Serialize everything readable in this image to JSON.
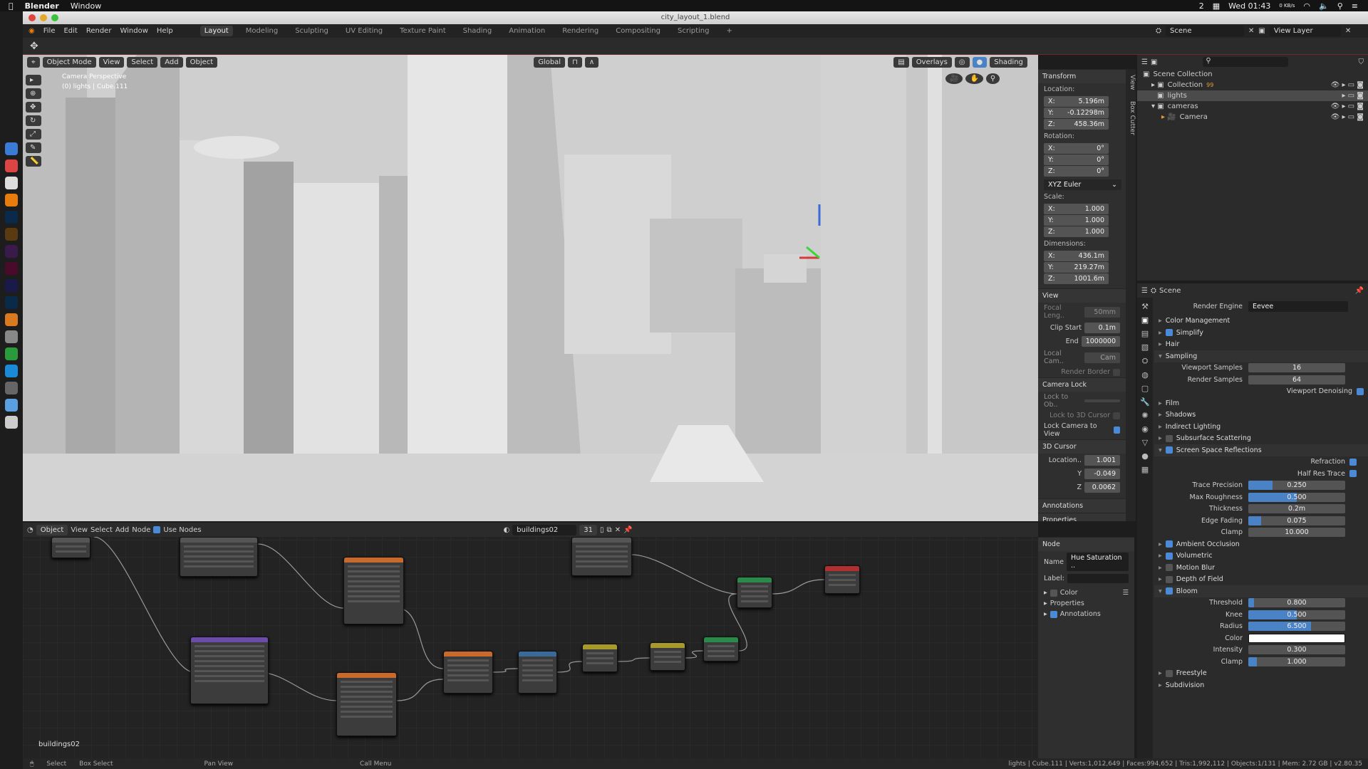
{
  "mac": {
    "app": "Blender",
    "menu": "Window",
    "clock": "Wed 01:43",
    "badge": "2",
    "net": "0 KB/s"
  },
  "window": {
    "title": "city_layout_1.blend"
  },
  "topbar": {
    "menus": [
      "File",
      "Edit",
      "Render",
      "Window",
      "Help"
    ],
    "workspaces": [
      "Layout",
      "Modeling",
      "Sculpting",
      "UV Editing",
      "Texture Paint",
      "Shading",
      "Animation",
      "Rendering",
      "Compositing",
      "Scripting",
      "+"
    ],
    "active": "Layout",
    "scene": "Scene",
    "view_layer": "View Layer"
  },
  "viewport": {
    "mode": "Object Mode",
    "menus": [
      "View",
      "Select",
      "Add",
      "Object"
    ],
    "orientation": "Global",
    "overlays": "Overlays",
    "shading": "Shading",
    "info1": "Camera Perspective",
    "info2": "(0) lights | Cube.111"
  },
  "npanel": {
    "tabs": [
      "View",
      "Box Cutter"
    ],
    "transform": {
      "title": "Transform",
      "location_label": "Location:",
      "location": [
        [
          "X:",
          "5.196m"
        ],
        [
          "Y:",
          "-0.12298m"
        ],
        [
          "Z:",
          "458.36m"
        ]
      ],
      "rotation_label": "Rotation:",
      "rotation": [
        [
          "X:",
          "0°"
        ],
        [
          "Y:",
          "0°"
        ],
        [
          "Z:",
          "0°"
        ]
      ],
      "rotation_mode": "XYZ Euler",
      "scale_label": "Scale:",
      "scale": [
        [
          "X:",
          "1.000"
        ],
        [
          "Y:",
          "1.000"
        ],
        [
          "Z:",
          "1.000"
        ]
      ],
      "dimensions_label": "Dimensions:",
      "dimensions": [
        [
          "X:",
          "436.1m"
        ],
        [
          "Y:",
          "219.27m"
        ],
        [
          "Z:",
          "1001.6m"
        ]
      ]
    },
    "view": {
      "title": "View",
      "focal_label": "Focal Leng..",
      "focal": "50mm",
      "clip_start_label": "Clip Start",
      "clip_start": "0.1m",
      "end_label": "End",
      "end": "1000000",
      "local_cam_label": "Local Cam..",
      "local_cam": "Cam",
      "render_border": "Render Border"
    },
    "camera_lock": {
      "title": "Camera Lock",
      "lock_to_obj": "Lock to Ob..",
      "lock_cursor": "Lock to 3D Cursor",
      "lock_view": "Lock Camera to View"
    },
    "cursor": {
      "title": "3D Cursor",
      "location_label": "Location..",
      "x": "1.001",
      "y_label": "Y",
      "y": "-0.049",
      "z_label": "Z",
      "z": "0.0062"
    },
    "annotations": "Annotations",
    "properties": "Properties"
  },
  "outliner": {
    "items": [
      {
        "name": "Scene Collection",
        "indent": 0
      },
      {
        "name": "Collection",
        "indent": 1,
        "badge": "99"
      },
      {
        "name": "lights",
        "indent": 1,
        "selected": true
      },
      {
        "name": "cameras",
        "indent": 1
      },
      {
        "name": "Camera",
        "indent": 2
      }
    ]
  },
  "properties": {
    "context": "Scene",
    "render_engine_label": "Render Engine",
    "render_engine": "Eevee",
    "sections_a": [
      {
        "name": "Color Management"
      },
      {
        "name": "Simplify",
        "check": true
      },
      {
        "name": "Hair"
      },
      {
        "name": "Sampling",
        "open": true
      }
    ],
    "viewport_samples_label": "Viewport Samples",
    "viewport_samples": "16",
    "render_samples_label": "Render Samples",
    "render_samples": "64",
    "denoise_label": "Viewport Denoising",
    "sections_b": [
      {
        "name": "Film"
      },
      {
        "name": "Shadows"
      },
      {
        "name": "Indirect Lighting"
      },
      {
        "name": "Subsurface Scattering",
        "check": false
      },
      {
        "name": "Screen Space Reflections",
        "check": true,
        "open": true
      }
    ],
    "refraction_label": "Refraction",
    "half_res_label": "Half Res Trace",
    "ssr": [
      {
        "label": "Trace Precision",
        "value": "0.250",
        "fill": 0.25
      },
      {
        "label": "Max Roughness",
        "value": "0.500",
        "fill": 0.5
      },
      {
        "label": "Thickness",
        "value": "0.2m",
        "fill": 0
      },
      {
        "label": "Edge Fading",
        "value": "0.075",
        "fill": 0.13
      },
      {
        "label": "Clamp",
        "value": "10.000",
        "fill": 0
      }
    ],
    "sections_c": [
      {
        "name": "Ambient Occlusion",
        "check": true
      },
      {
        "name": "Volumetric",
        "check": true
      },
      {
        "name": "Motion Blur",
        "check": false
      },
      {
        "name": "Depth of Field",
        "check": false
      },
      {
        "name": "Bloom",
        "check": true,
        "open": true
      }
    ],
    "bloom": [
      {
        "label": "Threshold",
        "value": "0.800",
        "fill": 0.06
      },
      {
        "label": "Knee",
        "value": "0.500",
        "fill": 0.5
      },
      {
        "label": "Radius",
        "value": "6.500",
        "fill": 0.65
      },
      {
        "label": "Color",
        "value": "",
        "color": "#ffffff"
      },
      {
        "label": "Intensity",
        "value": "0.300",
        "fill": 0
      },
      {
        "label": "Clamp",
        "value": "1.000",
        "fill": 0.09
      }
    ],
    "sections_d": [
      {
        "name": "Freestyle",
        "check": false
      },
      {
        "name": "Subdivision"
      }
    ]
  },
  "node_editor": {
    "type": "Object",
    "menus": [
      "View",
      "Select",
      "Add",
      "Node"
    ],
    "use_nodes": "Use Nodes",
    "material": "buildings02",
    "users": "31",
    "footer": "buildings02",
    "sidebar": {
      "title": "Node",
      "name_label": "Name",
      "name": "Hue Saturation ..",
      "label_label": "Label:",
      "color": "Color",
      "properties": "Properties",
      "annotations": "Annotations"
    }
  },
  "status": {
    "select": "Select",
    "box_select": "Box Select",
    "pan": "Pan View",
    "menu": "Call Menu",
    "stats": "lights | Cube.111 | Verts:1,012,649 | Faces:994,652 | Tris:1,992,112 | Objects:1/131 | Mem: 2.72 GB | v2.80.35"
  },
  "colors": {
    "accent": "#4a82c6",
    "node_orange": "#c96a2a",
    "node_purple": "#6b4ca8",
    "node_yellow": "#a89a2a",
    "node_green": "#2a8a4a",
    "node_red": "#b03030"
  }
}
